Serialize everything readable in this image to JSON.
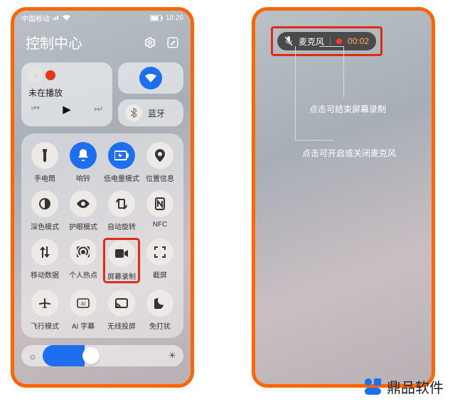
{
  "left": {
    "status": {
      "carrier": "中国移动",
      "time": "18:26"
    },
    "header": {
      "title": "控制中心"
    },
    "media": {
      "not_playing": "未在播放"
    },
    "conn": {
      "bt_label": "蓝牙"
    },
    "tiles": [
      {
        "id": "flashlight",
        "label": "手电筒",
        "active": false
      },
      {
        "id": "ring",
        "label": "响铃",
        "active": true
      },
      {
        "id": "battery-saver",
        "label": "低电量模式",
        "active": true
      },
      {
        "id": "location",
        "label": "位置信息",
        "active": false
      },
      {
        "id": "dark-mode",
        "label": "深色模式",
        "active": false
      },
      {
        "id": "eye-comfort",
        "label": "护眼模式",
        "active": false
      },
      {
        "id": "auto-rotate",
        "label": "自动旋转",
        "active": false
      },
      {
        "id": "nfc",
        "label": "NFC",
        "active": false
      },
      {
        "id": "mobile-data",
        "label": "移动数据",
        "active": false
      },
      {
        "id": "hotspot",
        "label": "个人热点",
        "active": false
      },
      {
        "id": "screen-record",
        "label": "屏幕录制",
        "active": false,
        "highlight": true
      },
      {
        "id": "screenshot",
        "label": "截屏",
        "active": false
      },
      {
        "id": "airplane",
        "label": "飞行模式",
        "active": false
      },
      {
        "id": "ai-subtitle",
        "label": "AI 字幕",
        "active": false
      },
      {
        "id": "cast",
        "label": "无线投屏",
        "active": false
      },
      {
        "id": "dnd",
        "label": "免打扰",
        "active": false
      }
    ]
  },
  "right": {
    "pill": {
      "mic_label": "麦克风",
      "timer": "00:02"
    },
    "callouts": {
      "stop": "点击可结束屏幕录制",
      "mic": "点击可开启或关闭麦克风"
    }
  },
  "brand": {
    "name": "鼎品软件"
  }
}
